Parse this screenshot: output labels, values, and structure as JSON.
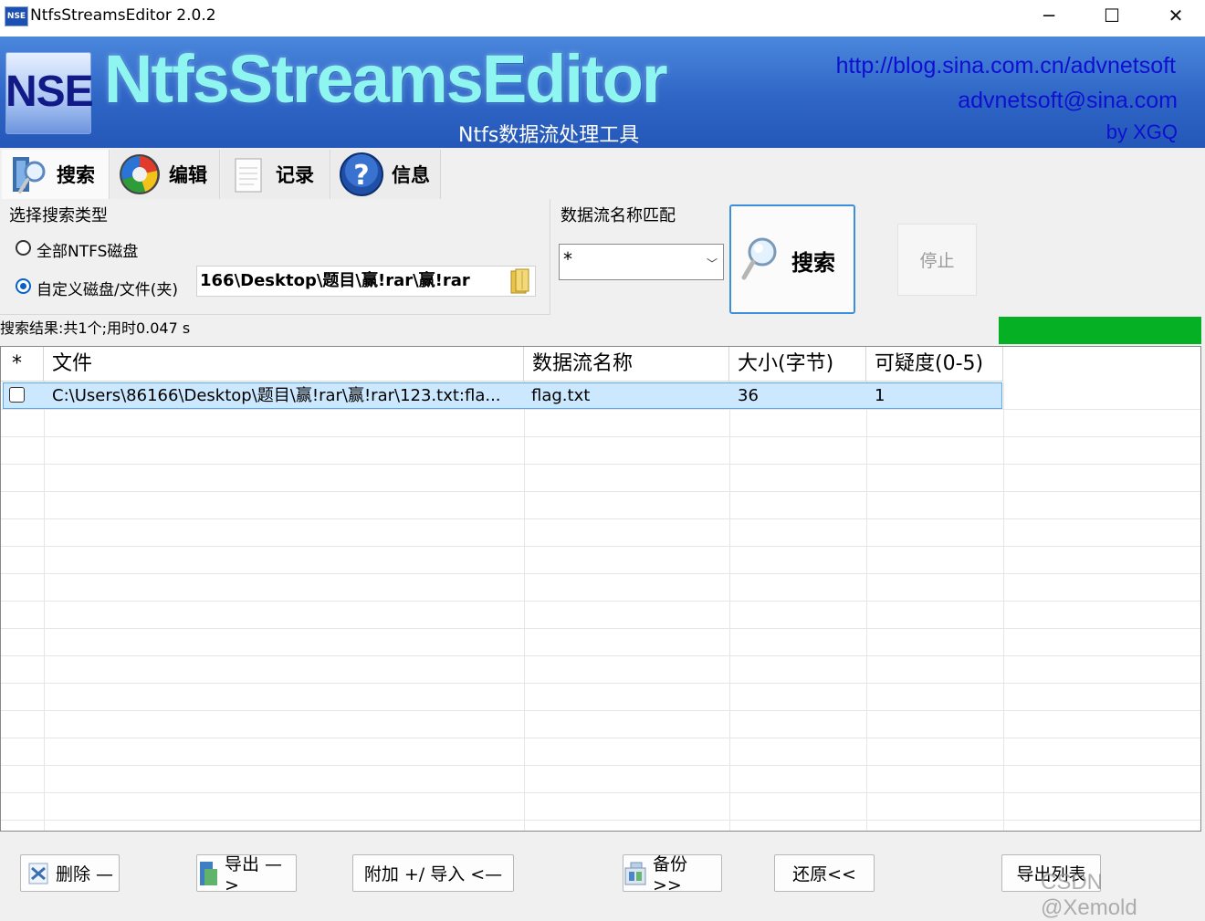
{
  "window": {
    "title": "NtfsStreamsEditor 2.0.2",
    "icon_text": "NSE",
    "minimize": "─",
    "maximize": "☐",
    "close": "✕"
  },
  "banner": {
    "logo_text": "NSE",
    "brand": "NtfsStreamsEditor",
    "subtitle": "Ntfs数据流处理工具",
    "link_blog": "http://blog.sina.com.cn/advnetsoft",
    "link_email": "advnetsoft@sina.com",
    "author": "by XGQ"
  },
  "tabs": [
    {
      "label": "搜索",
      "icon": "search-tab-icon"
    },
    {
      "label": "编辑",
      "icon": "edit-tab-icon"
    },
    {
      "label": "记录",
      "icon": "log-tab-icon"
    },
    {
      "label": "信息",
      "icon": "info-tab-icon"
    }
  ],
  "search_type": {
    "group_label": "选择搜索类型",
    "option_all": "全部NTFS磁盘",
    "option_custom": "自定义磁盘/文件(夹)",
    "selected": "custom",
    "path_value": "166\\Desktop\\题目\\赢!rar\\赢!rar"
  },
  "stream_match": {
    "group_label": "数据流名称匹配",
    "value": "*"
  },
  "search_button": "搜索",
  "stop_button": "停止",
  "status_text": "搜索结果:共1个;用时0.047 s",
  "progress_fraction": 1.0,
  "colors": {
    "progress": "#06b025",
    "selected_row": "#cce8ff",
    "link": "#0f0fd1"
  },
  "table": {
    "columns": [
      "*",
      "文件",
      "数据流名称",
      "大小(字节)",
      "可疑度(0-5)"
    ],
    "rows": [
      {
        "checked": false,
        "file": "C:\\Users\\86166\\Desktop\\题目\\赢!rar\\赢!rar\\123.txt:fla...",
        "stream": "flag.txt",
        "size": "36",
        "suspicion": "1"
      }
    ]
  },
  "bottom_buttons": {
    "delete": "删除 —",
    "export": "导出 —>",
    "attach_import": "附加 +/ 导入 <—",
    "backup": "备份  >>",
    "restore": "还原<<",
    "export_list": "导出列表"
  },
  "watermark": "CSDN @Xemold"
}
